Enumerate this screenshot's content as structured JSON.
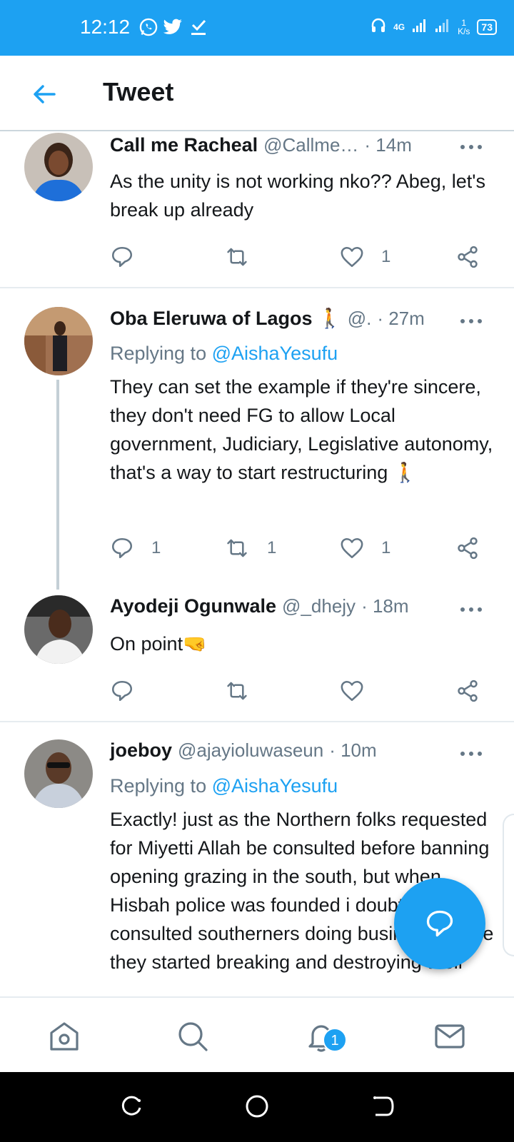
{
  "status_bar": {
    "time": "12:12",
    "network": "4G",
    "speed_value": "1",
    "speed_unit": "K/s",
    "battery": "73",
    "bg_color": "#1da1f2"
  },
  "header": {
    "title": "Tweet",
    "back_icon": "arrow-left-icon"
  },
  "tweets": [
    {
      "name": "Call me Racheal",
      "handle": "@Callme…",
      "time": "· 14m",
      "replying_prefix": "",
      "replying_mention": "",
      "text": "As the unity is not working nko??  Abeg, let's break up already",
      "reply_count": "",
      "retweet_count": "",
      "like_count": "1"
    },
    {
      "name": "Oba Eleruwa of Lagos 🚶",
      "handle": "@.",
      "time": "· 27m",
      "replying_prefix": "Replying to ",
      "replying_mention": "@AishaYesufu",
      "text": "They can set the example if they're sincere, they don't need FG to allow Local government, Judiciary, Legislative autonomy, that's a way to start restructuring  🚶",
      "reply_count": "1",
      "retweet_count": "1",
      "like_count": "1"
    },
    {
      "name": "Ayodeji Ogunwale",
      "handle": "@_dhejy",
      "time": "· 18m",
      "replying_prefix": "",
      "replying_mention": "",
      "text": "On point🤜",
      "reply_count": "",
      "retweet_count": "",
      "like_count": ""
    },
    {
      "name": "joeboy",
      "handle": "@ajayioluwaseun",
      "time": "· 10m",
      "replying_prefix": "Replying to ",
      "replying_mention": "@AishaYesufu",
      "text": "Exactly! just as the Northern folks requested for Miyetti Allah be consulted before banning opening grazing in the south, but when Hisbah police was founded i doubt it if they consulted southerners doing business before they started breaking and destroying their",
      "reply_count": "",
      "retweet_count": "",
      "like_count": ""
    }
  ],
  "bottom_nav": {
    "items": [
      "home-icon",
      "search-icon",
      "notifications-icon",
      "messages-icon"
    ],
    "notification_badge": "1"
  },
  "fab": {
    "icon": "compose-reply-icon"
  },
  "colors": {
    "accent": "#1da1f2",
    "muted": "#657786",
    "text": "#14171a"
  }
}
